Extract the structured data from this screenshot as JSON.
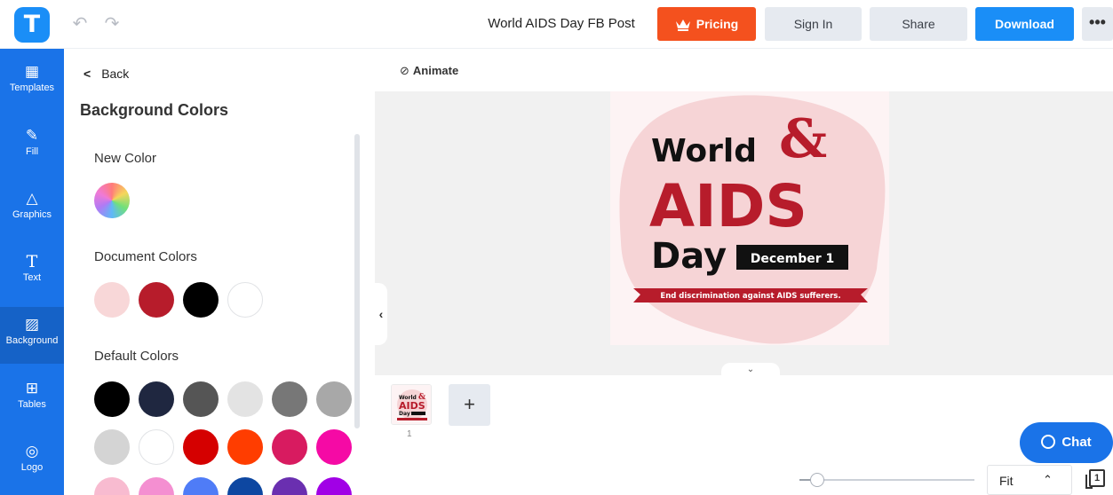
{
  "app": {
    "logo_letter": "T"
  },
  "header": {
    "undo_icon": "undo-icon",
    "redo_icon": "redo-icon",
    "document_title": "World AIDS Day FB Post",
    "pricing_label": "Pricing",
    "signin_label": "Sign In",
    "share_label": "Share",
    "download_label": "Download",
    "more_label": "•••"
  },
  "sidebar": {
    "items": [
      {
        "label": "Templates",
        "icon": "templates-icon",
        "glyph": "▦"
      },
      {
        "label": "Fill",
        "icon": "pencil-icon",
        "glyph": "✎"
      },
      {
        "label": "Graphics",
        "icon": "shapes-icon",
        "glyph": "△"
      },
      {
        "label": "Text",
        "icon": "text-icon",
        "glyph": "T"
      },
      {
        "label": "Background",
        "icon": "background-icon",
        "glyph": "▨",
        "active": true
      },
      {
        "label": "Tables",
        "icon": "table-icon",
        "glyph": "⊞"
      },
      {
        "label": "Logo",
        "icon": "logo-icon",
        "glyph": "◎"
      }
    ]
  },
  "panel": {
    "back_label": "Back",
    "title": "Background Colors",
    "new_color_label": "New Color",
    "document_colors_label": "Document Colors",
    "document_colors": [
      "#f8d7d8",
      "#b71c2b",
      "#000000",
      "#ffffff"
    ],
    "default_colors_label": "Default Colors",
    "default_colors": [
      [
        "#000000",
        "#1f2740",
        "#555555",
        "#e3e3e3",
        "#777777",
        "#a8a8a8"
      ],
      [
        "#d4d4d4",
        "#ffffff",
        "#d50000",
        "#ff3d00",
        "#d81b60",
        "#f50aa5"
      ],
      [
        "#f8bbd0",
        "#f48fd1",
        "#4f7cf7",
        "#0d47a1",
        "#6a2fb0",
        "#a100e6"
      ]
    ]
  },
  "canvas": {
    "animate_label": "Animate",
    "design": {
      "line1": "World",
      "ampersand": "&",
      "line2": "AIDS",
      "line3": "Day",
      "date": "December 1",
      "tagline": "End discrimination against AIDS sufferers.",
      "colors": {
        "red": "#b71c2b",
        "pink": "#f6d4d6",
        "black": "#111111"
      }
    }
  },
  "pages": {
    "thumbnail_number": "1",
    "add_label": "+"
  },
  "chat": {
    "label": "Chat"
  },
  "zoom": {
    "value": "Fit",
    "slider_fraction": 0.1
  },
  "pages_count_label": "1"
}
